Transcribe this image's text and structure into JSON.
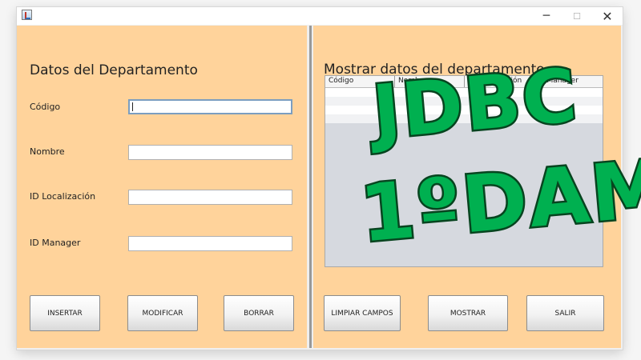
{
  "window": {
    "app_icon": "java-app-icon",
    "controls": {
      "minimize": "─",
      "maximize": "☐",
      "close": "✕"
    }
  },
  "form": {
    "heading": "Datos del Departamento",
    "fields": [
      {
        "label": "Código",
        "value": ""
      },
      {
        "label": "Nombre",
        "value": ""
      },
      {
        "label": "ID Localización",
        "value": ""
      },
      {
        "label": "ID Manager",
        "value": ""
      }
    ],
    "buttons": {
      "insertar": "INSERTAR",
      "modificar": "MODIFICAR",
      "borrar": "BORRAR"
    }
  },
  "table_panel": {
    "heading": "Mostrar datos del departamento",
    "columns": [
      "Código",
      "Nombre",
      "ID Localización",
      "ID Manager"
    ],
    "buttons": {
      "limpiar": "LIMPIAR CAMPOS",
      "mostrar": "MOSTRAR",
      "salir": "SALIR"
    }
  },
  "overlay": {
    "line1": "JDBC",
    "line2": "1ºDAM",
    "fill_color": "#00b050",
    "outline_color": "#07441f"
  },
  "colors": {
    "panel_bg": "#ffd39b",
    "table_bg": "#d6d9df"
  }
}
